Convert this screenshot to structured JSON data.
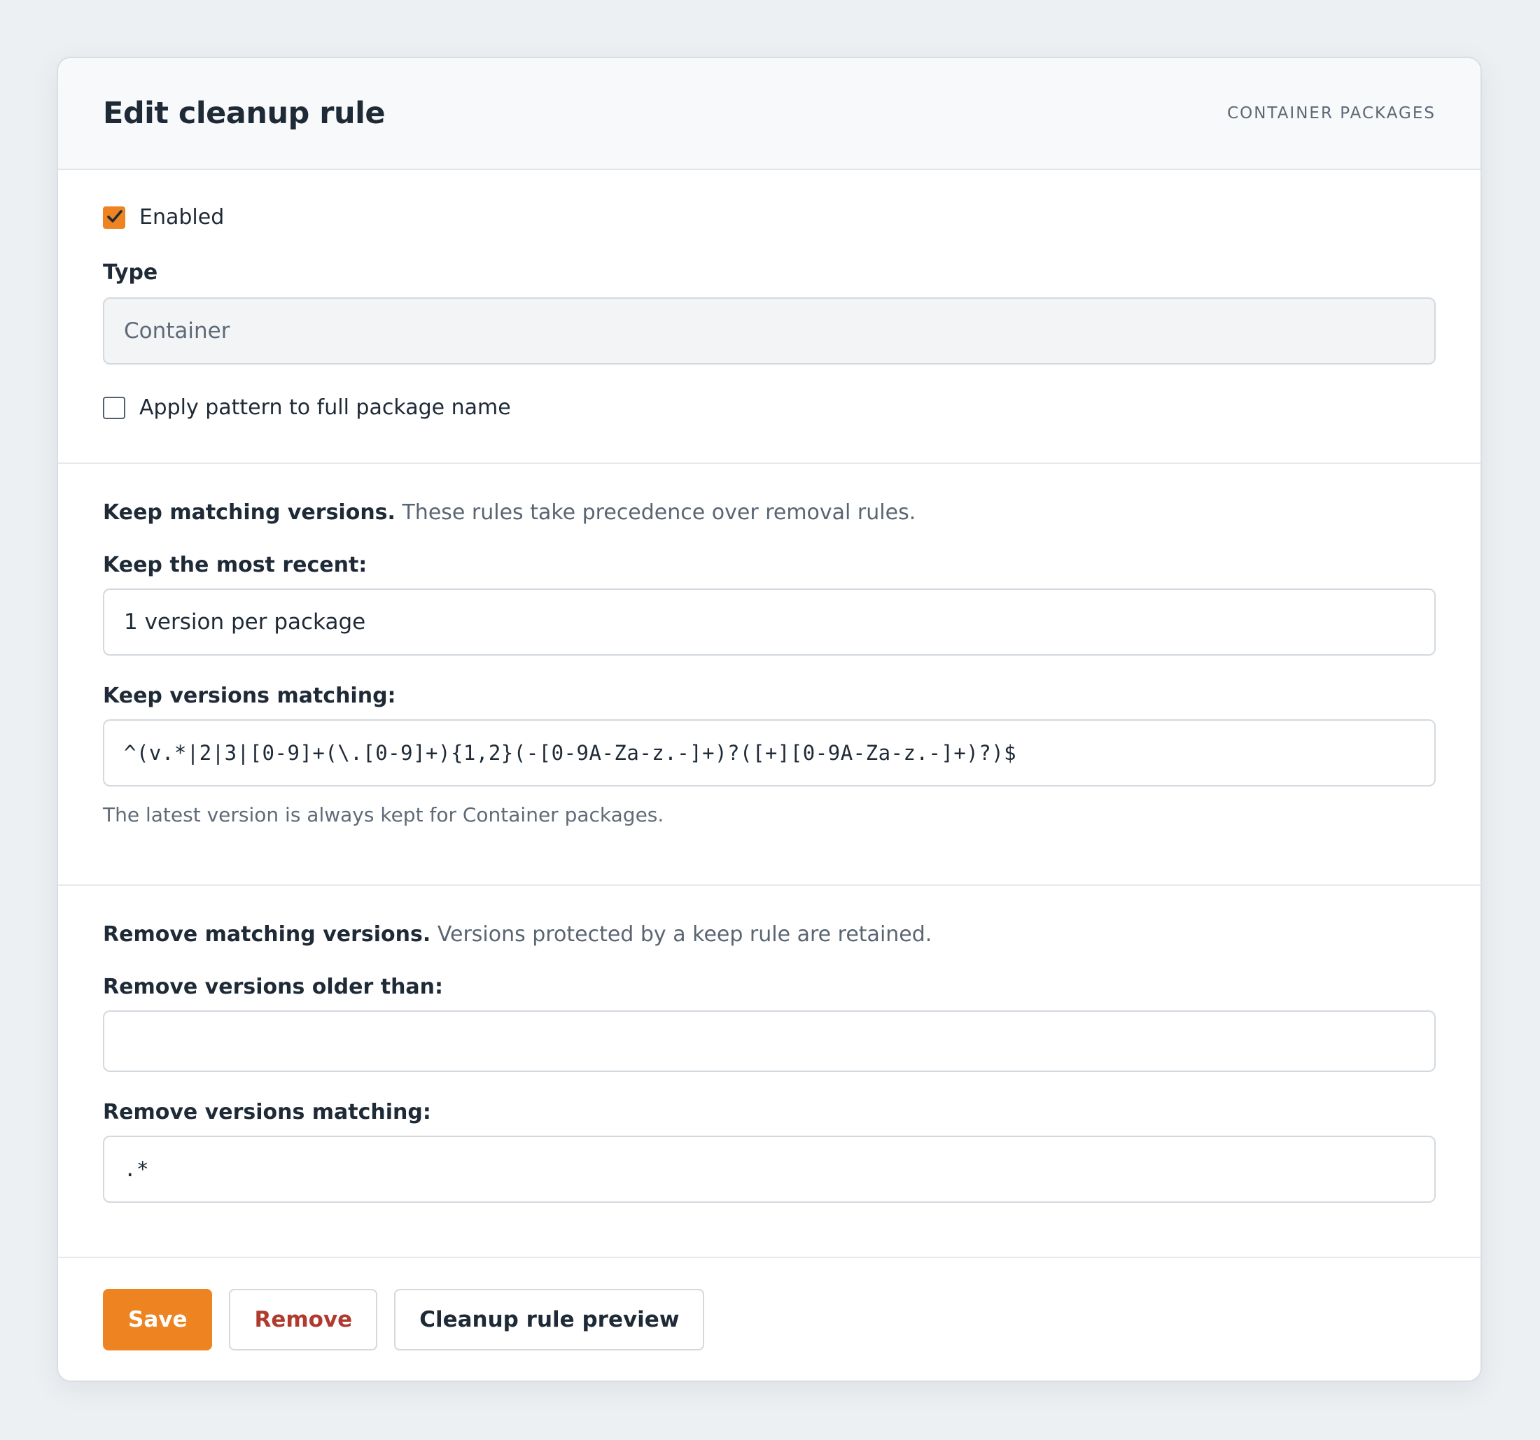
{
  "header": {
    "title": "Edit cleanup rule",
    "subtitle": "CONTAINER PACKAGES"
  },
  "general": {
    "enabled_label": "Enabled",
    "enabled_checked": true,
    "type_label": "Type",
    "type_value": "Container",
    "full_name_label": "Apply pattern to full package name",
    "full_name_checked": false
  },
  "keep": {
    "intro_strong": "Keep matching versions.",
    "intro_text": " These rules take precedence over removal rules.",
    "most_recent_label": "Keep the most recent:",
    "most_recent_value": "1 version per package",
    "matching_label": "Keep versions matching:",
    "matching_value": "^(v.*|2|3|[0-9]+(\\.[0-9]+){1,2}(-[0-9A-Za-z.-]+)?([+][0-9A-Za-z.-]+)?)$",
    "help": "The latest version is always kept for Container packages."
  },
  "remove": {
    "intro_strong": "Remove matching versions.",
    "intro_text": " Versions protected by a keep rule are retained.",
    "older_label": "Remove versions older than:",
    "older_value": "",
    "matching_label": "Remove versions matching:",
    "matching_value": ".*"
  },
  "actions": {
    "save_label": "Save",
    "remove_label": "Remove",
    "preview_label": "Cleanup rule preview"
  },
  "colors": {
    "accent": "#ee8322",
    "danger": "#b03a2e",
    "background": "#edf0f3"
  }
}
